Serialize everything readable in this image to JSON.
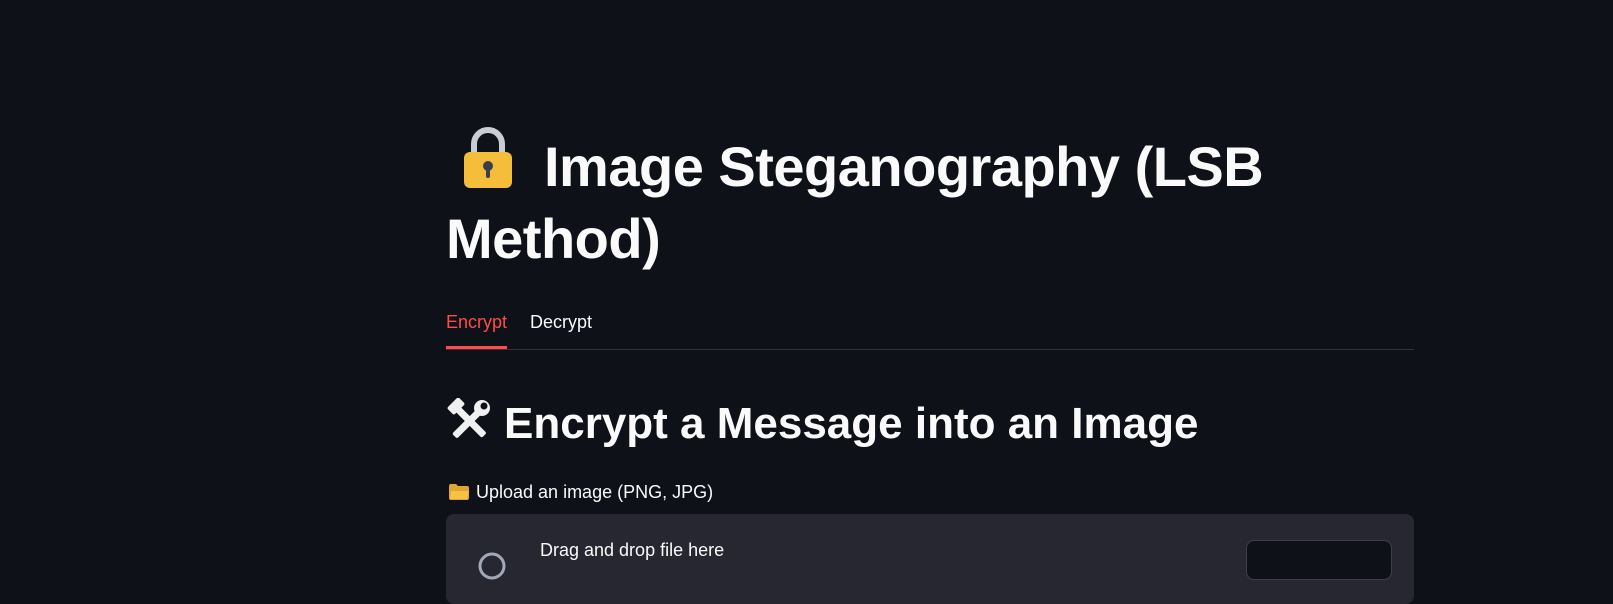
{
  "page": {
    "title": "Image Steganography (LSB Method)",
    "title_icon": "lock-icon"
  },
  "tabs": [
    {
      "label": "Encrypt",
      "active": true
    },
    {
      "label": "Decrypt",
      "active": false
    }
  ],
  "encrypt": {
    "subheader": "Encrypt a Message into an Image",
    "subheader_icon": "hammer-wrench-icon",
    "upload_label": "Upload an image (PNG, JPG)",
    "upload_label_icon": "folder-icon",
    "dropzone_text": "Drag and drop file here",
    "dropzone_icon": "upload-cloud-icon"
  },
  "colors": {
    "background": "#0e1117",
    "text": "#fafafa",
    "accent": "#ff4b4b",
    "dropzone": "#262730"
  }
}
